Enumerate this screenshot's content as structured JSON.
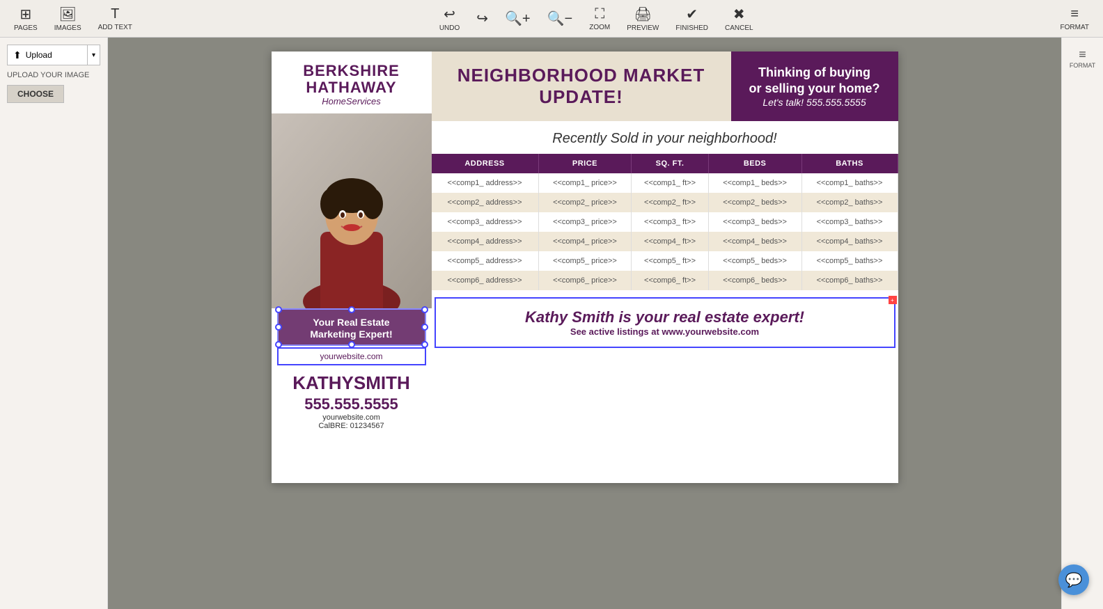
{
  "toolbar": {
    "pages_label": "PAGES",
    "images_label": "IMAGES",
    "add_text_label": "ADD TEXT",
    "undo_label": "UNDO",
    "zoom_label": "ZOOM",
    "preview_label": "PREVIEW",
    "finished_label": "FINISHED",
    "cancel_label": "CANCEL",
    "format_label": "FORMAT"
  },
  "left_panel": {
    "upload_btn_label": "Upload",
    "upload_your_image_label": "UPLOAD YOUR IMAGE",
    "choose_label": "CHOOSE"
  },
  "flyer": {
    "brand": {
      "line1": "BERKSHIRE",
      "line2": "HATHAWAY",
      "sub": "HomeServices"
    },
    "header": {
      "main_text": "NEIGHBORHOOD MARKET UPDATE!",
      "cta_line1": "Thinking of buying",
      "cta_line2": "or selling your home?",
      "cta_phone": "Let's talk! 555.555.5555"
    },
    "recently_sold": "Recently Sold in your neighborhood!",
    "table": {
      "headers": [
        "ADDRESS",
        "PRICE",
        "SQ. FT.",
        "BEDS",
        "BATHS"
      ],
      "rows": [
        [
          "<<comp1_ address>>",
          "<<comp1_ price>>",
          "<<comp1_ ft>>",
          "<<comp1_ beds>>",
          "<<comp1_ baths>>"
        ],
        [
          "<<comp2_ address>>",
          "<<comp2_ price>>",
          "<<comp2_ ft>>",
          "<<comp2_ beds>>",
          "<<comp2_ baths>>"
        ],
        [
          "<<comp3_ address>>",
          "<<comp3_ price>>",
          "<<comp3_ ft>>",
          "<<comp3_ beds>>",
          "<<comp3_ baths>>"
        ],
        [
          "<<comp4_ address>>",
          "<<comp4_ price>>",
          "<<comp4_ ft>>",
          "<<comp4_ beds>>",
          "<<comp4_ baths>>"
        ],
        [
          "<<comp5_ address>>",
          "<<comp5_ price>>",
          "<<comp5_ ft>>",
          "<<comp5_ beds>>",
          "<<comp5_ baths>>"
        ],
        [
          "<<comp6_ address>>",
          "<<comp6_ price>>",
          "<<comp6_ ft>>",
          "<<comp6_ beds>>",
          "<<comp6_ baths>>"
        ]
      ]
    },
    "agent": {
      "tagline_line1": "Your Real Estate",
      "tagline_line2": "Marketing Expert!",
      "website_box": "yourwebsite.com",
      "name_first": "KATHY",
      "name_last": "SMITH",
      "phone": "555.555.5555",
      "website": "yourwebsite.com",
      "bre": "CalBRE: 01234567"
    },
    "footer": {
      "main_text": "Kathy Smith is your real estate expert!",
      "sub_text": "See active listings at www.yourwebsite.com"
    }
  }
}
